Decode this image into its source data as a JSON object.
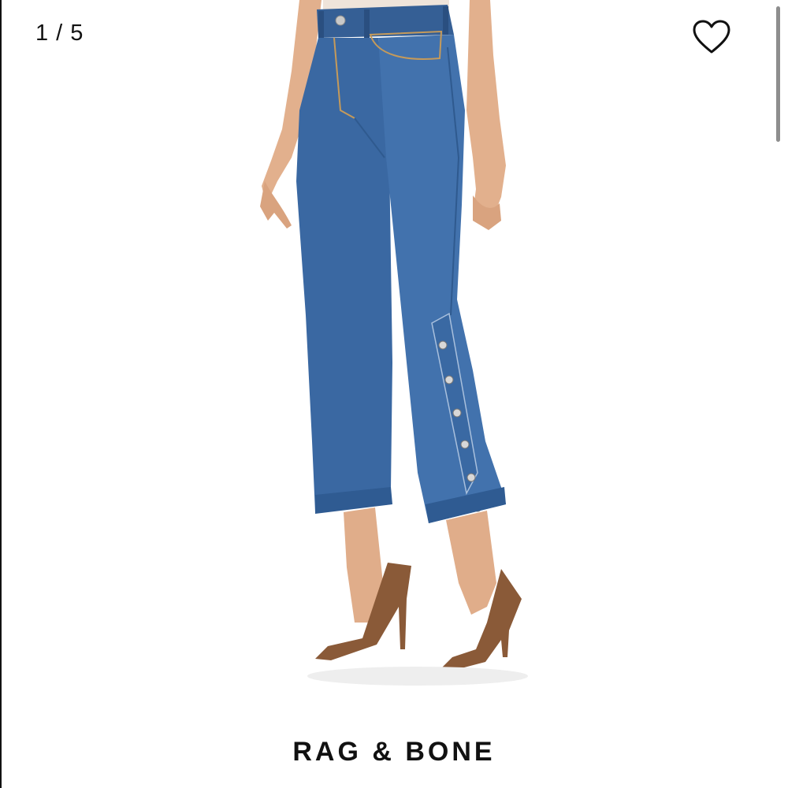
{
  "gallery": {
    "counter": "1 / 5"
  },
  "favorite": {
    "icon": "heart-outline-icon"
  },
  "product": {
    "brand": "RAG & BONE"
  },
  "colors": {
    "denim": "#3f6fa8",
    "denim_dark": "#2f5a8f",
    "skin": "#e2b08d",
    "heel": "#8a5a38"
  }
}
